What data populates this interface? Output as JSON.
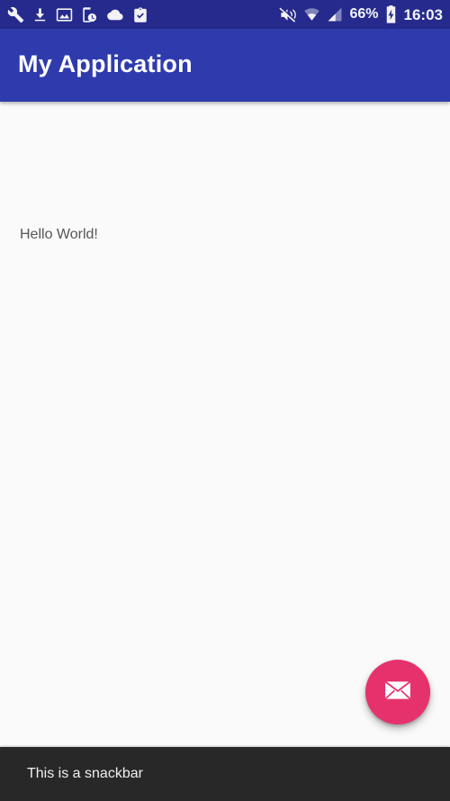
{
  "status_bar": {
    "background_color": "#252a8c",
    "left_icons": [
      {
        "name": "wrench-icon",
        "label": "Developer tools"
      },
      {
        "name": "download-icon",
        "label": "Download complete"
      },
      {
        "name": "image-icon",
        "label": "Screenshot captured"
      },
      {
        "name": "device-clock-icon",
        "label": "Device timer"
      },
      {
        "name": "cloud-icon",
        "label": "Cloud sync"
      },
      {
        "name": "clipboard-check-icon",
        "label": "Task complete"
      }
    ],
    "right_icons": [
      {
        "name": "vibrate-mute-icon",
        "label": "Ringer muted / vibrate"
      },
      {
        "name": "wifi-icon",
        "label": "Wi-Fi connected"
      },
      {
        "name": "cellular-signal-icon",
        "label": "Cellular signal"
      },
      {
        "name": "battery-charging-icon",
        "label": "Battery charging"
      }
    ],
    "battery_percent": "66%",
    "time": "16:03"
  },
  "app_bar": {
    "title": "My Application",
    "background_color": "#2f3bad",
    "text_color": "#ffffff"
  },
  "content": {
    "background_color": "#fafafa",
    "hello_text": "Hello World!",
    "hello_text_color": "#555555"
  },
  "fab": {
    "name": "email-fab",
    "icon": "envelope-icon",
    "background_color": "#e5326d",
    "icon_color": "#ffffff"
  },
  "snackbar": {
    "message": "This is a snackbar",
    "background_color": "#282828",
    "text_color": "#f0f0f0"
  }
}
